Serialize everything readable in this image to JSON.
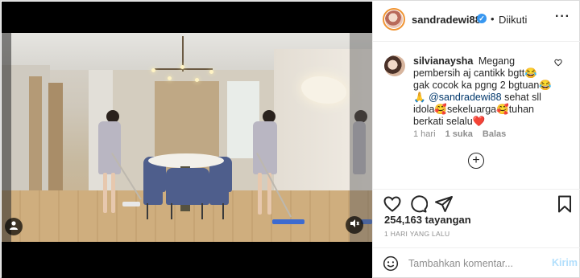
{
  "header": {
    "username": "sandradewi88",
    "verified_icon": "verified-badge-icon",
    "separator": "•",
    "follow_status": "Diikuti",
    "more_icon": "more-options-icon"
  },
  "comment": {
    "username": "silvianaysha",
    "text": "Megang pembersih aj cantikk bgtt😂gak cocok ka pgng 2 bgtuan😂🙏",
    "mention": "@sandradewi88",
    "text_after_mention": " sehat sll idola🥰sekeluarga🥰tuhan berkati selalu❤️",
    "time": "1 hari",
    "likes": "1 suka",
    "reply": "Balas"
  },
  "actions": {
    "like_icon": "heart-icon",
    "comment_icon": "comment-icon",
    "share_icon": "share-icon",
    "save_icon": "bookmark-icon"
  },
  "stats": {
    "views": "254,163 tayangan",
    "date": "1 HARI YANG LALU"
  },
  "add_comment": {
    "placeholder": "Tambahkan komentar...",
    "post_label": "Kirim"
  },
  "video": {
    "user_tag_icon": "user-tag-icon",
    "sound_icon": "speaker-muted-icon"
  },
  "colors": {
    "link": "#00376b",
    "post_disabled": "#b2dffc",
    "verified": "#3897f0",
    "muted_text": "#8e8e8e"
  }
}
